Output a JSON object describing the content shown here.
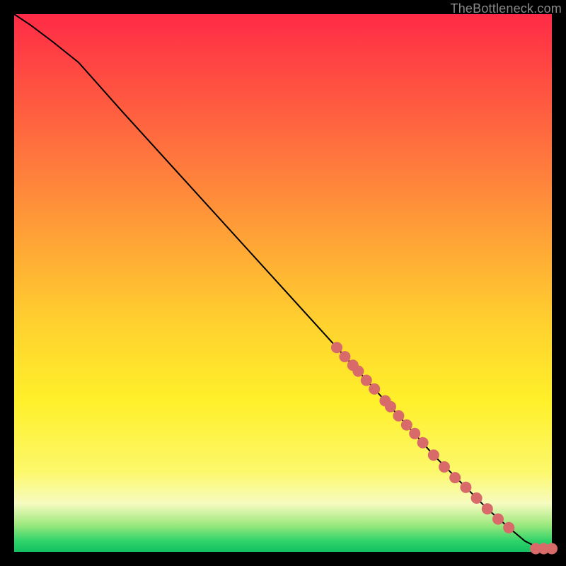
{
  "watermark": "TheBottleneck.com",
  "chart_data": {
    "type": "line",
    "title": "",
    "xlabel": "",
    "ylabel": "",
    "xlim": [
      0,
      100
    ],
    "ylim": [
      0,
      100
    ],
    "grid": false,
    "legend": false,
    "line": {
      "x": [
        0,
        3,
        7,
        12,
        20,
        30,
        40,
        50,
        60,
        70,
        78,
        84,
        88,
        92,
        95,
        97,
        98.5,
        100
      ],
      "y": [
        100,
        98,
        95,
        91,
        82,
        71,
        60,
        49,
        38,
        27,
        18,
        12,
        8,
        4.5,
        2,
        1,
        0.6,
        0.6
      ]
    },
    "markers_along_line": {
      "color": "#d96a6a",
      "radius_px": 8,
      "x": [
        60,
        61.5,
        63,
        64,
        65.5,
        67,
        69,
        70,
        71.5,
        73,
        74.5,
        76,
        78,
        80,
        82,
        84,
        86,
        88,
        90,
        92
      ],
      "y": [
        38,
        36.3,
        34.7,
        33.6,
        31.9,
        30.3,
        28.1,
        27,
        25.3,
        23.6,
        22,
        20.3,
        18,
        15.8,
        13.8,
        12,
        10,
        8,
        6.1,
        4.5
      ]
    },
    "markers_tail": {
      "color": "#d96a6a",
      "radius_px": 8,
      "points": [
        {
          "x": 97,
          "y": 0.6
        },
        {
          "x": 98.5,
          "y": 0.6
        },
        {
          "x": 100,
          "y": 0.6
        }
      ]
    }
  }
}
